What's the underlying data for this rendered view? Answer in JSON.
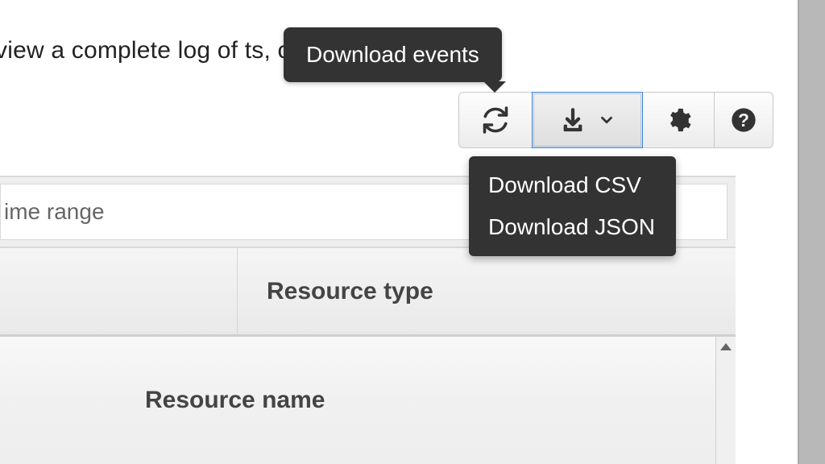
{
  "intro": {
    "text": "view a complete log of                              ts, create a trail"
  },
  "tooltip": {
    "label": "Download events"
  },
  "toolbar": {
    "refresh": "Refresh",
    "download": "Download events",
    "settings": "Settings",
    "help": "Help"
  },
  "menu": {
    "items": [
      "Download CSV",
      "Download JSON"
    ]
  },
  "filters": {
    "time_range_placeholder": "ime range"
  },
  "table": {
    "columns": {
      "resource_type": "Resource type"
    },
    "sub_header": {
      "resource_name": "Resource name"
    }
  }
}
